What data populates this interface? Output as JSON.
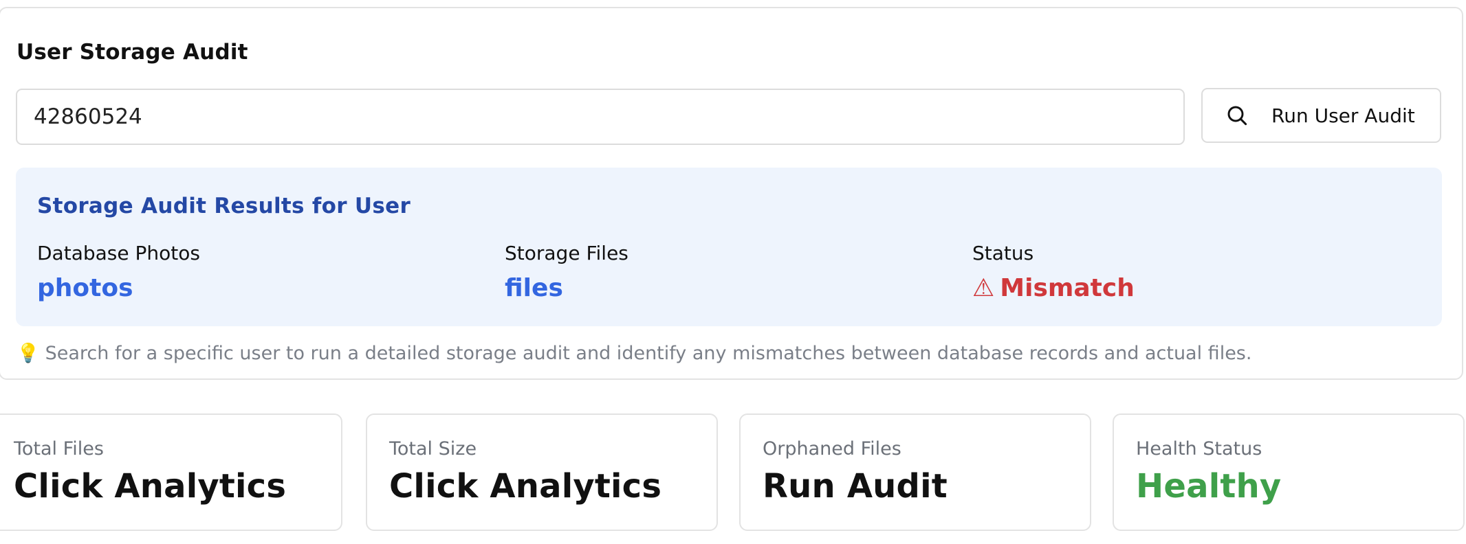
{
  "audit": {
    "title": "User Storage Audit",
    "user_id_value": "42860524",
    "run_button_label": "Run User Audit",
    "results": {
      "title": "Storage Audit Results for User",
      "database_photos_label": "Database Photos",
      "database_photos_value": "photos",
      "storage_files_label": "Storage Files",
      "storage_files_value": "files",
      "status_label": "Status",
      "status_icon": "⚠",
      "status_value": "Mismatch"
    },
    "hint_icon": "💡",
    "hint_text": "Search for a specific user to run a detailed storage audit and identify any mismatches between database records and actual files."
  },
  "metrics": [
    {
      "label": "Total Files",
      "value": "Click Analytics"
    },
    {
      "label": "Total Size",
      "value": "Click Analytics"
    },
    {
      "label": "Orphaned Files",
      "value": "Run Audit"
    },
    {
      "label": "Health Status",
      "value": "Healthy"
    }
  ],
  "colors": {
    "accent_blue": "#3366e0",
    "results_title": "#2448a5",
    "mismatch_red": "#d0383b",
    "healthy_green": "#3fa04a",
    "results_bg": "#eef4fd"
  },
  "icons": {
    "run_button": "search-icon",
    "status": "warning-icon",
    "hint": "lightbulb-icon"
  }
}
